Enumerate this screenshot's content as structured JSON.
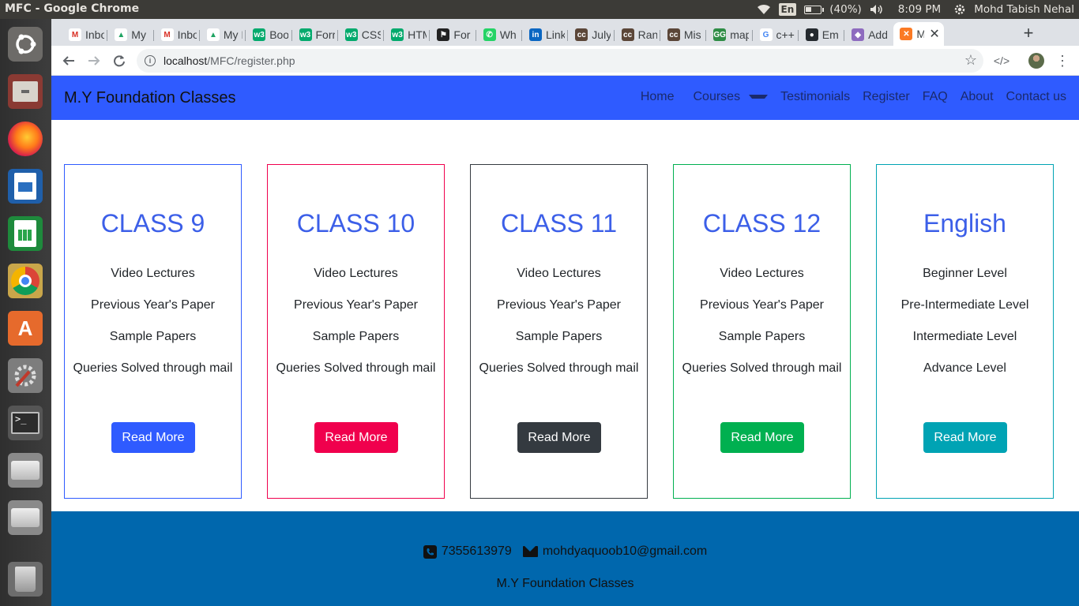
{
  "os_panel": {
    "window_title": "MFC - Google Chrome",
    "language": "En",
    "battery": "(40%)",
    "time": "8:09 PM",
    "user": "Mohd Tabish Nehal"
  },
  "launcher": {
    "items": [
      "ubuntu-dash",
      "file-manager",
      "firefox",
      "libreoffice-writer",
      "libreoffice-calc",
      "chrome",
      "software-center",
      "system-settings",
      "terminal",
      "disk-drive",
      "disk-drive",
      "trash"
    ]
  },
  "browser": {
    "tabs": [
      {
        "title": "Inbox",
        "icon": "gmail-icon"
      },
      {
        "title": "My D",
        "icon": "drive-icon"
      },
      {
        "title": "Inbox",
        "icon": "gmail-icon"
      },
      {
        "title": "My D",
        "icon": "drive-icon"
      },
      {
        "title": "Boo",
        "icon": "w3-icon"
      },
      {
        "title": "Forr",
        "icon": "w3-icon"
      },
      {
        "title": "CSS",
        "icon": "w3-icon"
      },
      {
        "title": "HTM",
        "icon": "w3-icon"
      },
      {
        "title": "For",
        "icon": "flag-icon"
      },
      {
        "title": "Wh",
        "icon": "whatsapp-icon"
      },
      {
        "title": "Link",
        "icon": "linkedin-icon"
      },
      {
        "title": "July",
        "icon": "codechef-icon"
      },
      {
        "title": "Ran",
        "icon": "codechef-icon"
      },
      {
        "title": "Mis",
        "icon": "codechef-icon"
      },
      {
        "title": "map",
        "icon": "gfg-icon"
      },
      {
        "title": "c++",
        "icon": "google-icon"
      },
      {
        "title": "Em",
        "icon": "github-icon"
      },
      {
        "title": "Add",
        "icon": "extension-icon"
      },
      {
        "title": "M",
        "icon": "xampp-icon"
      }
    ],
    "url_host": "localhost",
    "url_path": "/MFC/register.php"
  },
  "site": {
    "brand": "M.Y Foundation Classes",
    "nav": [
      "Home",
      "Courses",
      "Testimonials",
      "Register",
      "FAQ",
      "About",
      "Contact us"
    ],
    "cards": [
      {
        "title": "CLASS 9",
        "features": [
          "Video Lectures",
          "Previous Year's Paper",
          "Sample Papers",
          "Queries Solved through mail"
        ],
        "button": "Read More",
        "color": "#2f5bff"
      },
      {
        "title": "CLASS 10",
        "features": [
          "Video Lectures",
          "Previous Year's Paper",
          "Sample Papers",
          "Queries Solved through mail"
        ],
        "button": "Read More",
        "color": "#f0004d"
      },
      {
        "title": "CLASS 11",
        "features": [
          "Video Lectures",
          "Previous Year's Paper",
          "Sample Papers",
          "Queries Solved through mail"
        ],
        "button": "Read More",
        "color": "#343a40"
      },
      {
        "title": "CLASS 12",
        "features": [
          "Video Lectures",
          "Previous Year's Paper",
          "Sample Papers",
          "Queries Solved through mail"
        ],
        "button": "Read More",
        "color": "#00b050"
      },
      {
        "title": "English",
        "features": [
          "Beginner Level",
          "Pre-Intermediate Level",
          "Intermediate Level",
          "Advance Level"
        ],
        "button": "Read More",
        "color": "#00a3b4"
      }
    ],
    "footer": {
      "phone": "7355613979",
      "email": "mohdyaquoob10@gmail.com",
      "brand": "M.Y Foundation Classes"
    }
  }
}
